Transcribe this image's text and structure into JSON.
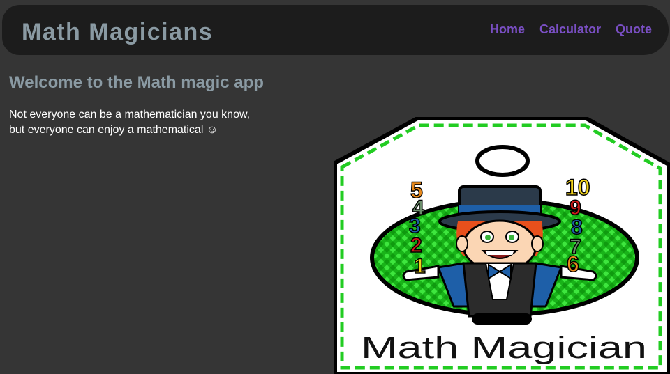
{
  "header": {
    "title": "Math Magicians",
    "nav": [
      {
        "label": "Home"
      },
      {
        "label": "Calculator"
      },
      {
        "label": "Quote"
      }
    ]
  },
  "main": {
    "heading": "Welcome to the Math magic app",
    "intro_line1": "Not everyone can be a mathematician you know,",
    "intro_line2": "but everyone can enjoy a mathematical ☺"
  },
  "hero": {
    "caption": "Math Magician",
    "left_numbers": [
      "5",
      "4",
      "3",
      "2",
      "1"
    ],
    "right_numbers": [
      "10",
      "9",
      "8",
      "7",
      "6"
    ]
  },
  "colors": {
    "background": "#353535",
    "navbar": "#1c1c1c",
    "brand_text": "#8a9aa3",
    "nav_link": "#7a4fc4",
    "tag_border": "#22cc22"
  }
}
